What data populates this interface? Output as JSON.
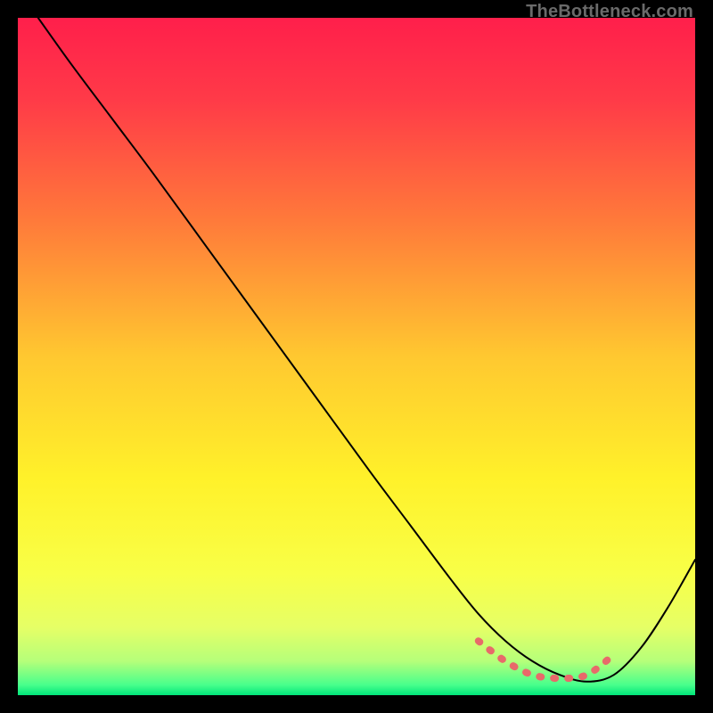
{
  "watermark": "TheBottleneck.com",
  "chart_data": {
    "type": "line",
    "title": "",
    "xlabel": "",
    "ylabel": "",
    "xlim": [
      0,
      100
    ],
    "ylim": [
      0,
      100
    ],
    "grid": false,
    "legend": false,
    "annotations": [],
    "gradient_stops": [
      {
        "offset": 0.0,
        "color": "#ff1f4b"
      },
      {
        "offset": 0.12,
        "color": "#ff3a48"
      },
      {
        "offset": 0.3,
        "color": "#ff7a3a"
      },
      {
        "offset": 0.5,
        "color": "#ffc830"
      },
      {
        "offset": 0.68,
        "color": "#fff12a"
      },
      {
        "offset": 0.82,
        "color": "#f8ff47"
      },
      {
        "offset": 0.9,
        "color": "#e6ff66"
      },
      {
        "offset": 0.95,
        "color": "#b5ff7a"
      },
      {
        "offset": 0.985,
        "color": "#48ff8c"
      },
      {
        "offset": 1.0,
        "color": "#00e57a"
      }
    ],
    "series": [
      {
        "name": "bottleneck-curve",
        "color": "#000000",
        "width": 2.0,
        "x": [
          3,
          8,
          14,
          20,
          28,
          36,
          44,
          52,
          58,
          64,
          68,
          72,
          76,
          80,
          84,
          88,
          92,
          96,
          100
        ],
        "y": [
          100,
          93,
          85,
          77,
          66,
          55,
          44,
          33,
          25,
          17,
          12,
          8,
          5,
          3,
          2,
          3,
          7,
          13,
          20
        ]
      },
      {
        "name": "optimal-marker",
        "color": "#e86a6a",
        "width": 8.0,
        "style": "dotted",
        "x": [
          68,
          72,
          76,
          80,
          84,
          88
        ],
        "y": [
          8,
          5,
          3,
          2.5,
          3,
          6
        ]
      }
    ]
  }
}
